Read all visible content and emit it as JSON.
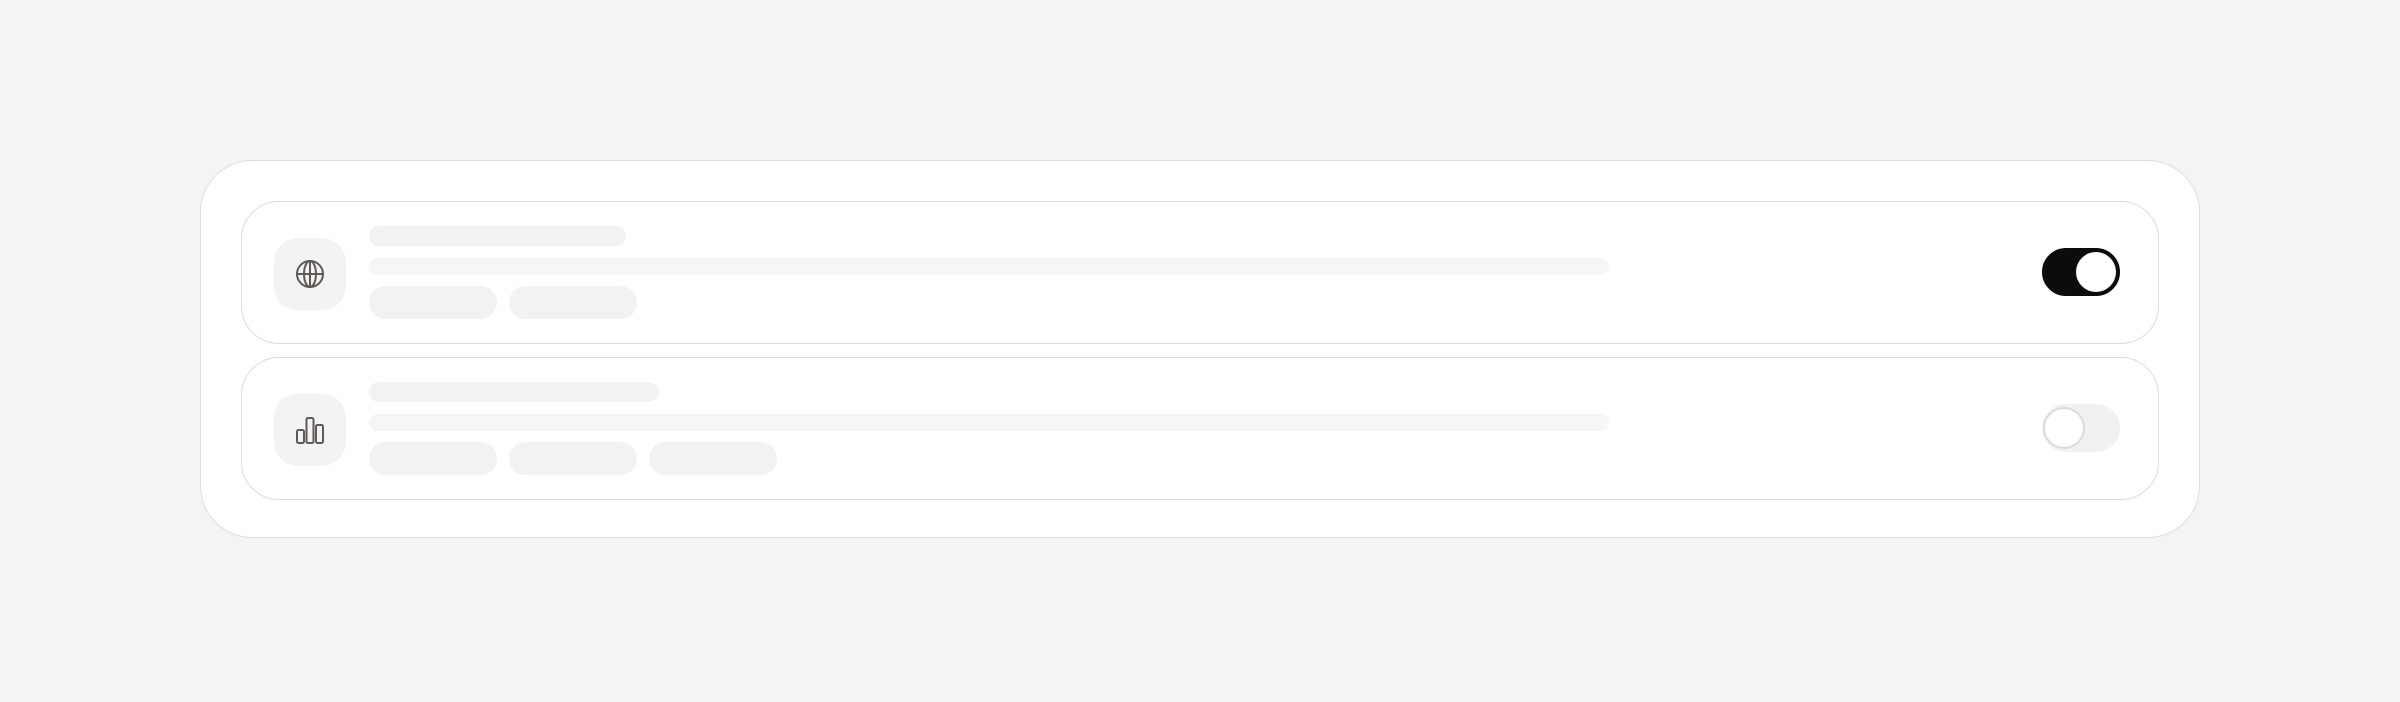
{
  "settings": {
    "rows": [
      {
        "icon": "globe-icon",
        "toggle": {
          "checked": true,
          "accent": "#0e0c0a"
        },
        "skeleton_chip_count": 2
      },
      {
        "icon": "bar-chart-icon",
        "toggle": {
          "checked": false
        },
        "skeleton_chip_count": 3
      }
    ]
  }
}
